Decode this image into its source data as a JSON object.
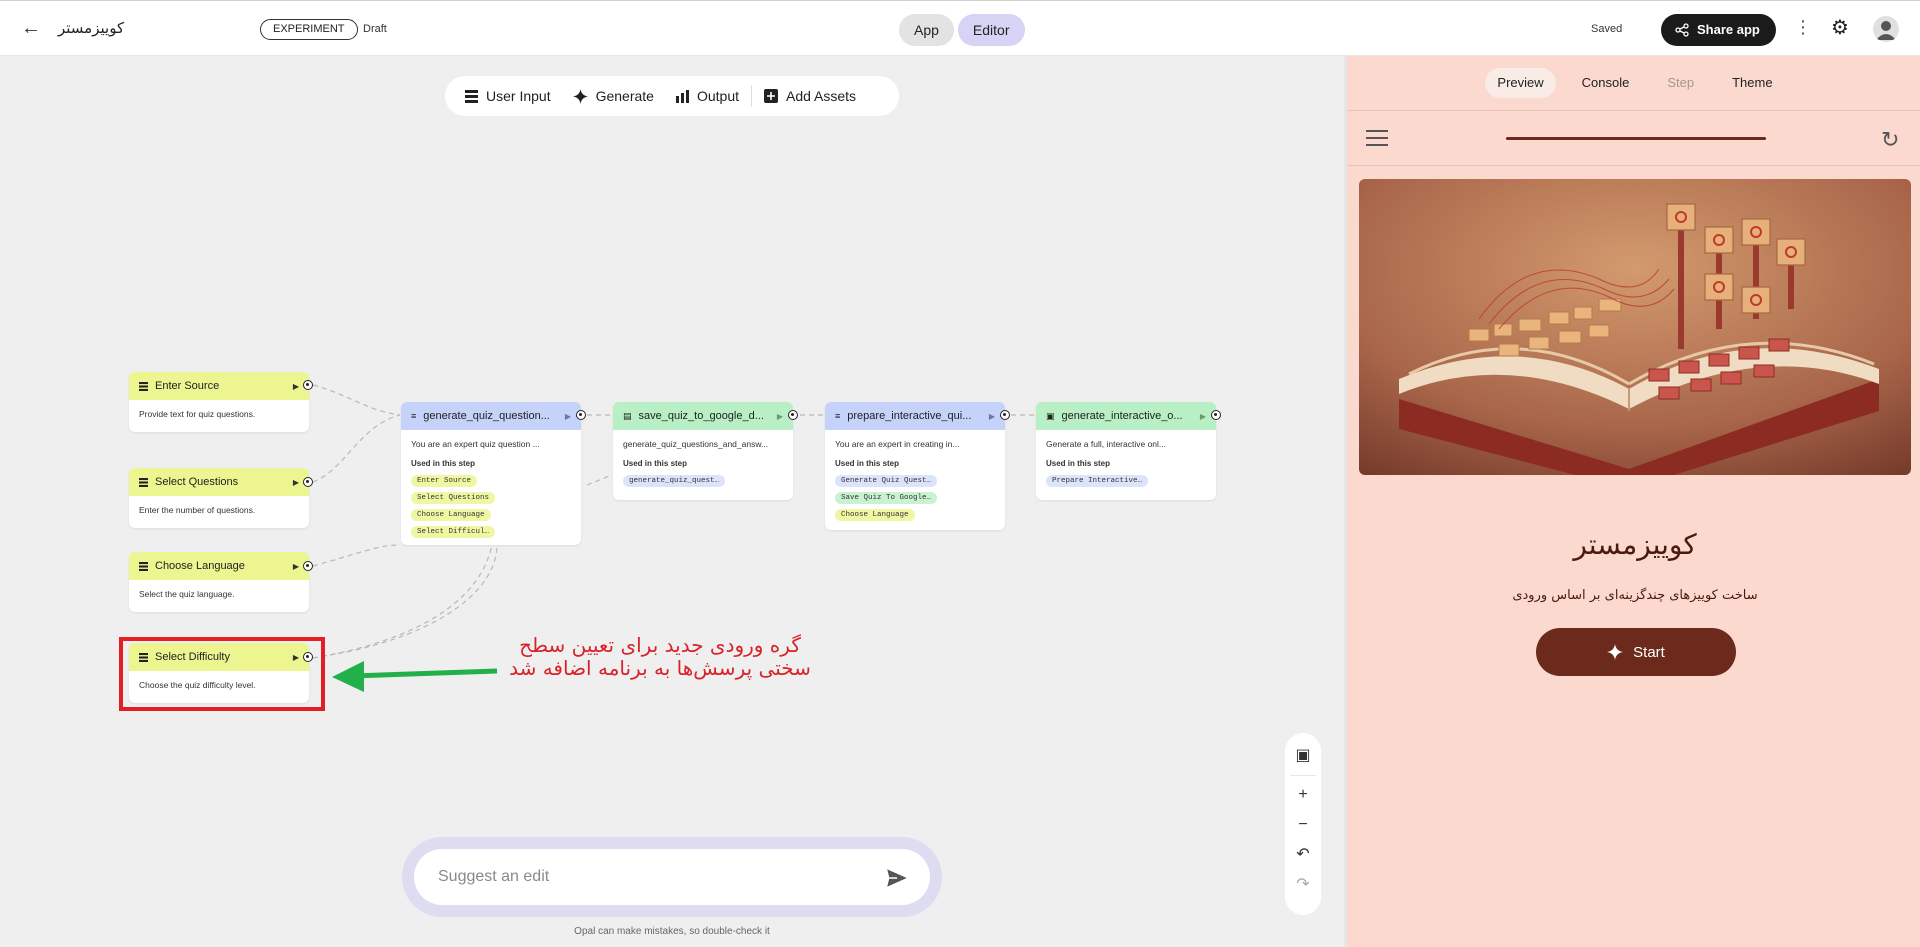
{
  "header": {
    "back_icon": "arrow-left-icon",
    "app_title": "کوییزمستر",
    "badge": "EXPERIMENT",
    "status": "Draft",
    "mode_app": "App",
    "mode_editor": "Editor",
    "saved": "Saved",
    "share": "Share app"
  },
  "toolbar": {
    "user_input": "User Input",
    "generate": "Generate",
    "output": "Output",
    "add_assets": "Add Assets"
  },
  "nodes": {
    "enter_source": {
      "title": "Enter Source",
      "desc": "Provide text for quiz questions."
    },
    "select_questions": {
      "title": "Select Questions",
      "desc": "Enter the number of questions."
    },
    "choose_language": {
      "title": "Choose Language",
      "desc": "Select the quiz language."
    },
    "select_difficulty": {
      "title": "Select Difficulty",
      "desc": "Choose the quiz difficulty level."
    },
    "generate_quiz": {
      "title": "generate_quiz_question...",
      "desc": "You are an expert quiz question ...",
      "used": "Used in this step",
      "chips": [
        "Enter Source",
        "Select Questions",
        "Choose Language",
        "Select Difficul…"
      ]
    },
    "save_quiz": {
      "title": "save_quiz_to_google_d...",
      "desc": "generate_quiz_questions_and_answ...",
      "used": "Used in this step",
      "chips": [
        "generate_quiz_quest…"
      ]
    },
    "prepare_interactive": {
      "title": "prepare_interactive_qui...",
      "desc": "You are an expert in creating in...",
      "used": "Used in this step",
      "chips": [
        "Generate Quiz Quest…",
        "Save Quiz To Google…",
        "Choose Language"
      ]
    },
    "generate_interactive": {
      "title": "generate_interactive_o...",
      "desc": "Generate a full, interactive onl...",
      "used": "Used in this step",
      "chips": [
        "Prepare Interactive…"
      ]
    }
  },
  "annotation": {
    "text": "گره ورودی جدید برای تعیین سطح سختی پرسش‌ها به برنامه اضافه شد",
    "color": "#e31e24",
    "arrow_color": "#22b04b"
  },
  "suggest": {
    "placeholder": "Suggest an edit",
    "disclaimer": "Opal can make mistakes, so double-check it"
  },
  "right_panel": {
    "tabs": [
      "Preview",
      "Console",
      "Step",
      "Theme"
    ],
    "active_tab": "Preview",
    "progress": 1.0,
    "title": "کوییزمستر",
    "subtitle": "ساخت کوییزهای چندگزینه‌ای بر اساس ورودی",
    "start": "Start"
  },
  "colors": {
    "panel_bg": "#fcd9cf",
    "accent": "#6b2a1c",
    "input_node": "#ecf590",
    "generate_node": "#c5d3fa",
    "output_node": "#b9efc5"
  }
}
